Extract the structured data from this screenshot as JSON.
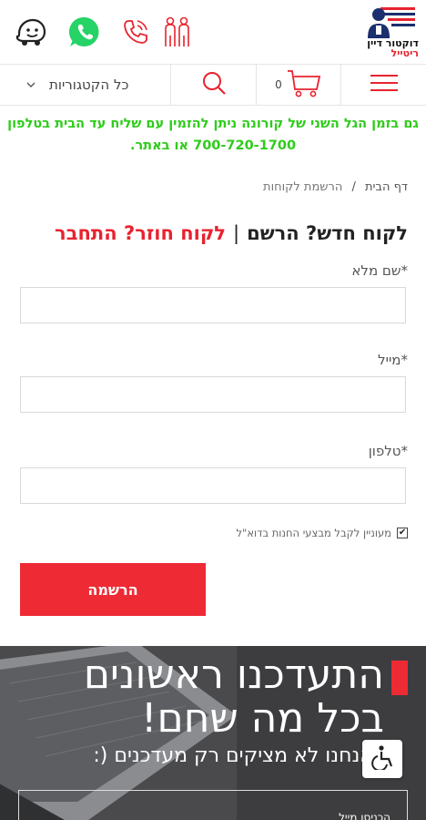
{
  "header": {
    "logo_line1": "דוקטור דיין",
    "logo_line2": "ריטייל",
    "icons": [
      "waze-icon",
      "whatsapp-icon",
      "phone-icon",
      "family-icon"
    ]
  },
  "toolbar": {
    "categories_label": "כל הקטגוריות",
    "cart_count": "0"
  },
  "notice": {
    "text": "גם בזמן הגל השני של קורונה ניתן להזמין עם שליח עד הבית בטלפון 700-720-1700 או באתר."
  },
  "breadcrumb": {
    "home": "דף הבית",
    "separator": "/",
    "current": "הרשמת לקוחות"
  },
  "form": {
    "new_customer": "לקוח חדש? הרשם",
    "divider": "|",
    "returning_customer": "לקוח חוזר? התחבר",
    "name_label": "*שם מלא",
    "email_label": "*מייל",
    "phone_label": "*טלפון",
    "name_value": "",
    "email_value": "",
    "phone_value": "",
    "newsletter_label": "מעוניין לקבל מבצעי החנות בדוא\"ל",
    "newsletter_checked": true,
    "submit_label": "הרשמה"
  },
  "banner": {
    "line1": "התעדכנו ראשונים",
    "line2": "בכל מה שחם!",
    "subline": "אנחנו לא מציקים רק מעדכנים (:",
    "box_text": "הכניסו מייל"
  },
  "colors": {
    "brand_red": "#ee2a35",
    "notice_green": "#2ecc1a",
    "banner_bg": "#3d3d3f"
  }
}
